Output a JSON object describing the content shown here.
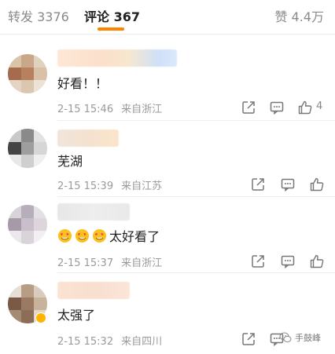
{
  "tabs": {
    "repost_label": "转发 3376",
    "comment_label": "评论 367",
    "like_label": "赞 4.4万",
    "accent_color": "#ff8200"
  },
  "comments": [
    {
      "text": "好看！！",
      "time": "2-15 15:46",
      "location": "来自浙江",
      "like_count": "4",
      "emoji_count": 0
    },
    {
      "text": "芜湖",
      "time": "2-15 15:39",
      "location": "来自江苏",
      "like_count": "",
      "emoji_count": 0
    },
    {
      "text": "太好看了",
      "time": "2-15 15:37",
      "location": "来自浙江",
      "like_count": "",
      "emoji_count": 3
    },
    {
      "text": "太强了",
      "time": "2-15 15:32",
      "location": "来自四川",
      "like_count": "",
      "emoji_count": 0
    }
  ],
  "icons": {
    "share": "share-icon",
    "reply": "comment-icon",
    "like": "thumbs-up-icon",
    "emoji": "heart-eyes-emoji-icon"
  },
  "watermark": {
    "text": "手鼓峰"
  }
}
